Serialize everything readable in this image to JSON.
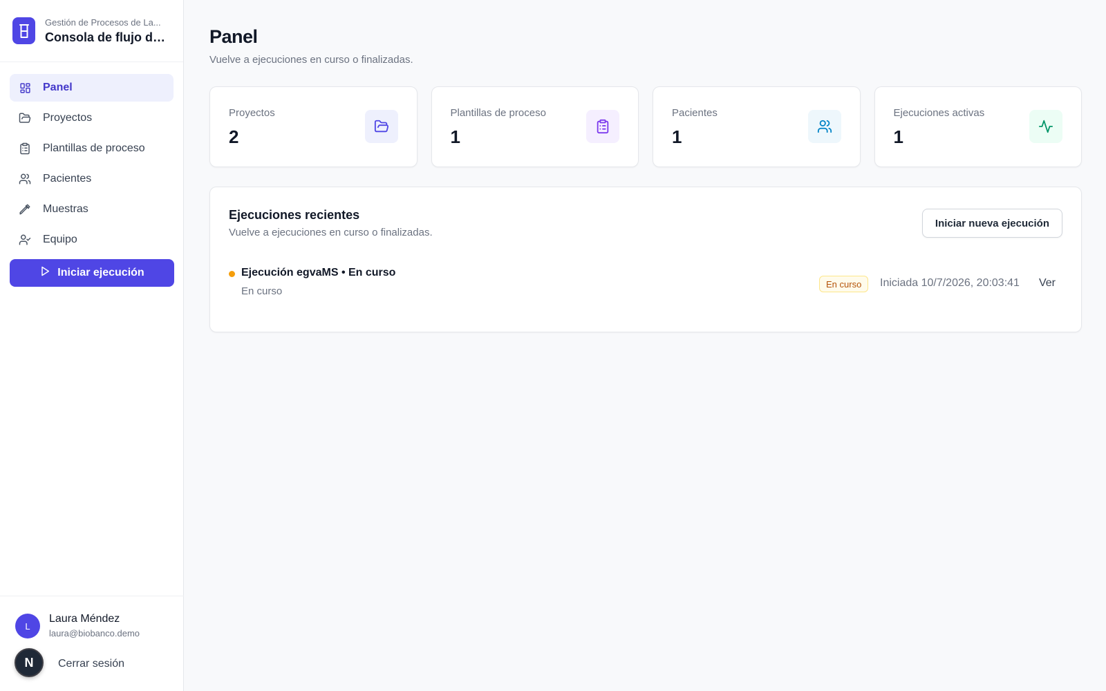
{
  "brand": {
    "subtitle": "Gestión de Procesos de La...",
    "title": "Consola de flujo de ..."
  },
  "nav": {
    "items": [
      {
        "label": "Panel",
        "icon": "dashboard-icon"
      },
      {
        "label": "Proyectos",
        "icon": "folder-icon"
      },
      {
        "label": "Plantillas de proceso",
        "icon": "clipboard-icon"
      },
      {
        "label": "Pacientes",
        "icon": "users-icon"
      },
      {
        "label": "Muestras",
        "icon": "pipette-icon"
      },
      {
        "label": "Equipo",
        "icon": "user-check-icon"
      }
    ],
    "start_label": "Iniciar ejecución"
  },
  "user": {
    "initial": "L",
    "name": "Laura Méndez",
    "email": "laura@biobanco.demo",
    "badge": "N",
    "logout_label": "Cerrar sesión"
  },
  "page": {
    "title": "Panel",
    "subtitle": "Vuelve a ejecuciones en curso o finalizadas."
  },
  "stats": [
    {
      "label": "Proyectos",
      "value": "2",
      "icon": "folder-open-icon",
      "bg": "#eef0fd",
      "color": "#4f46e5"
    },
    {
      "label": "Plantillas de proceso",
      "value": "1",
      "icon": "clipboard-list-icon",
      "bg": "#f5efff",
      "color": "#7c3aed"
    },
    {
      "label": "Pacientes",
      "value": "1",
      "icon": "users-icon",
      "bg": "#eef7fc",
      "color": "#0284c7"
    },
    {
      "label": "Ejecuciones activas",
      "value": "1",
      "icon": "activity-icon",
      "bg": "#ecfdf5",
      "color": "#059669"
    }
  ],
  "recent": {
    "title": "Ejecuciones recientes",
    "subtitle": "Vuelve a ejecuciones en curso o finalizadas.",
    "new_run_label": "Iniciar nueva ejecución",
    "runs": [
      {
        "title": "Ejecución egvaMS • En curso",
        "status_sub": "En curso",
        "badge": "En curso",
        "started": "Iniciada 10/7/2026, 20:03:41",
        "view_label": "Ver",
        "status_color": "#f59e0b"
      }
    ]
  }
}
